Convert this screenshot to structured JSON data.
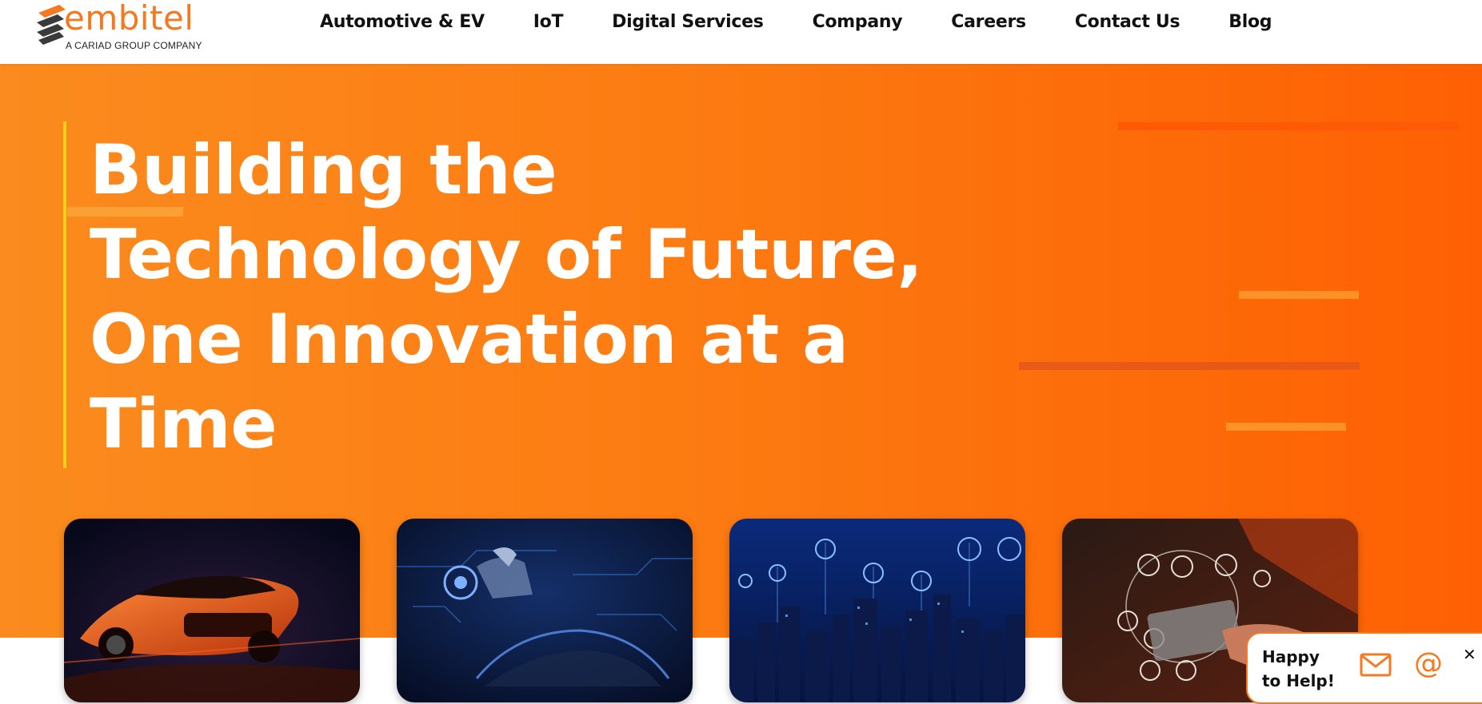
{
  "brand": {
    "name": "embitel",
    "tagline": "A CARIAD GROUP COMPANY",
    "color": "#f47920"
  },
  "nav": {
    "items": [
      {
        "label": "Automotive & EV"
      },
      {
        "label": "IoT"
      },
      {
        "label": "Digital Services"
      },
      {
        "label": "Company"
      },
      {
        "label": "Careers"
      },
      {
        "label": "Contact Us"
      },
      {
        "label": "Blog"
      }
    ]
  },
  "hero": {
    "title_lines": [
      "Building the",
      "Technology of Future,",
      "One Innovation at a",
      "Time"
    ],
    "background_start": "#fb8b1e",
    "background_end": "#fe6003",
    "accent_color": "#ffd21a"
  },
  "cards": [
    {
      "image": "orange-sports-car"
    },
    {
      "image": "digital-motorcycle-rider-and-car-wireframe"
    },
    {
      "image": "smart-city-skyline-with-icons"
    },
    {
      "image": "hand-holding-tablet-with-digital-icons"
    }
  ],
  "help_widget": {
    "line1": "Happy",
    "line2": "to Help!",
    "email_icon": "mail-icon",
    "at_icon": "at-icon",
    "close_label": "✕"
  }
}
